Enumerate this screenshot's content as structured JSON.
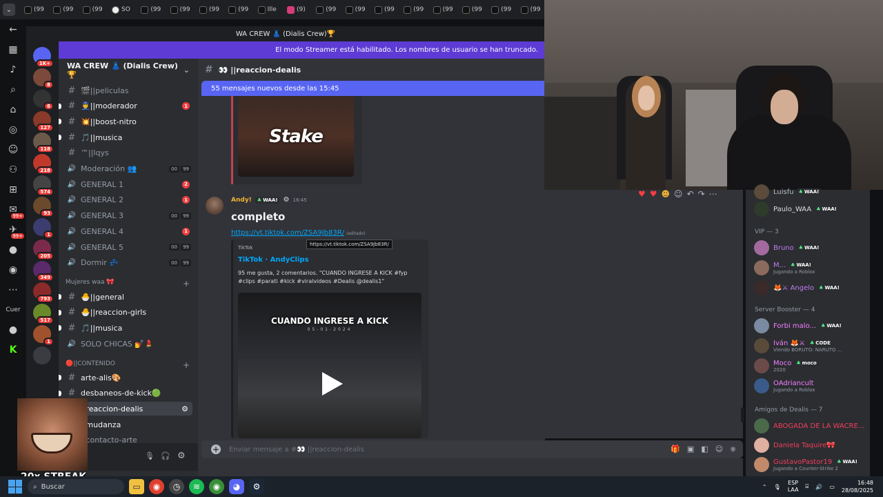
{
  "browser": {
    "tabs": [
      {
        "label": "(99",
        "icon": "tiktok"
      },
      {
        "label": "(99",
        "icon": "tiktok"
      },
      {
        "label": "(99",
        "icon": "tiktok"
      },
      {
        "label": "SO",
        "icon": "google"
      },
      {
        "label": "(99",
        "icon": "tiktok"
      },
      {
        "label": "(99",
        "icon": "tiktok"
      },
      {
        "label": "(99",
        "icon": "tiktok"
      },
      {
        "label": "(99",
        "icon": "tiktok"
      },
      {
        "label": "Ille",
        "icon": "tiktok"
      },
      {
        "label": "(9)",
        "icon": "instagram"
      },
      {
        "label": "(99",
        "icon": "tiktok"
      },
      {
        "label": "(99",
        "icon": "tiktok"
      },
      {
        "label": "(99",
        "icon": "tiktok"
      },
      {
        "label": "(99",
        "icon": "tiktok"
      },
      {
        "label": "(99",
        "icon": "tiktok"
      },
      {
        "label": "(99",
        "icon": "tiktok"
      },
      {
        "label": "(99",
        "icon": "tiktok"
      },
      {
        "label": "(99",
        "icon": "tiktok"
      }
    ],
    "rail_badges": {
      "b1": "99+",
      "b2": "99+"
    },
    "rail_cue_label": "Cuer"
  },
  "discord": {
    "window_title": "WA CREW 👗 (Dialis Crew)🏆",
    "streamer_notice": "El modo Streamer está habilitado. Los nombres de usuario se han truncado.",
    "guild_name": "WA CREW 👗 (Dialis Crew)🏆",
    "server_badges": [
      "1K+",
      "8",
      "6",
      "127",
      "118",
      "218",
      "574",
      "93",
      "1",
      "205",
      "349",
      "793",
      "517",
      "1"
    ],
    "channels": [
      {
        "name": "🎬||peliculas",
        "kind": "text",
        "unread": false,
        "badge": ""
      },
      {
        "name": "👮||moderador",
        "kind": "text",
        "unread": true,
        "badge": "1"
      },
      {
        "name": "💥||boost-nitro",
        "kind": "text",
        "unread": true,
        "badge": ""
      },
      {
        "name": "🎵||musica",
        "kind": "text",
        "unread": true,
        "badge": ""
      },
      {
        "name": "™||lqys",
        "kind": "text",
        "unread": false,
        "badge": ""
      },
      {
        "name": "Moderación 👥",
        "kind": "voice",
        "unread": false,
        "counts": [
          "00",
          "99"
        ]
      },
      {
        "name": "GENERAL 1",
        "kind": "voice",
        "unread": false,
        "badge": "2"
      },
      {
        "name": "GENERAL 2",
        "kind": "voice",
        "unread": false,
        "badge": "1"
      },
      {
        "name": "GENERAL 3",
        "kind": "voice",
        "unread": false,
        "counts": [
          "00",
          "99"
        ]
      },
      {
        "name": "GENERAL 4",
        "kind": "voice",
        "unread": false,
        "badge": "1"
      },
      {
        "name": "GENERAL 5",
        "kind": "voice",
        "unread": false,
        "counts": [
          "00",
          "99"
        ]
      },
      {
        "name": "Dormir 💤",
        "kind": "voice",
        "unread": false,
        "counts": [
          "00",
          "99"
        ]
      }
    ],
    "category_women": "Mujeres waa 🎀",
    "channels_women": [
      {
        "name": "🐣||general",
        "kind": "text",
        "unread": true
      },
      {
        "name": "🐣||reaccion-girls",
        "kind": "text",
        "unread": true
      },
      {
        "name": "🎵||musica",
        "kind": "text",
        "unread": true
      },
      {
        "name": "SOLO CHICAS 💅💄",
        "kind": "voice",
        "unread": false
      }
    ],
    "category_content": "🔴||CONTENIDO",
    "channels_content": [
      {
        "name": "arte-alis🎨",
        "kind": "text",
        "unread": true
      },
      {
        "name": "desbaneos-de-kick🟢",
        "kind": "text",
        "unread": true
      },
      {
        "name": "||reaccion-dealis",
        "kind": "text",
        "unread": true,
        "active": true
      },
      {
        "name": "||mudanza",
        "kind": "text",
        "unread": true
      },
      {
        "name": "||contacto-arte",
        "kind": "text",
        "unread": false
      }
    ],
    "active_channel_header": "👀 ||reaccion-dealis",
    "new_messages_bar": "55 mensajes nuevos desde las 15:45",
    "stake_text": "Stake",
    "message": {
      "author": "Andy!",
      "role_tag": "WAA!",
      "time": "16:45",
      "text": "completo",
      "link": "https://vt.tiktok.com/ZSA9Jb83R/",
      "edited": "(editado)",
      "tooltip": "https://vt.tiktok.com/ZSA9Jb83R/"
    },
    "embed": {
      "provider": "TikTok",
      "title": "TikTok · AndyClips",
      "description": "95 me gusta, 2 comentarios. \"CUANDO INGRESE A KICK #fyp #clips #parati #kick #viralvideos #Dealis @dealis1\"",
      "video_caption": "CUANDO INGRESE A KICK",
      "video_date": "05-01-2024"
    },
    "input_placeholder": "Enviar mensaje a #👀 ||reaccion-dealis",
    "members": {
      "top": [
        {
          "name": "Luisfu",
          "tag": "WAA!",
          "color": "#b5bac1"
        },
        {
          "name": "Paulo_WAA",
          "tag": "WAA!",
          "color": "#dbdee1"
        }
      ],
      "vip_header": "VIP — 3",
      "vip": [
        {
          "name": "Bruno",
          "tag": "WAA!",
          "color": "#c27cf0",
          "sub": ""
        },
        {
          "name": "M...",
          "tag": "WAA!",
          "color": "#c27cf0",
          "sub": "Jugando a Roblox"
        },
        {
          "name": "🦊⚔ Angelo",
          "tag": "WAA!",
          "color": "#c27cf0",
          "sub": ""
        }
      ],
      "booster_header": "Server Booster — 4",
      "boosters": [
        {
          "name": "Forbi malo...",
          "tag": "WAA!",
          "color": "#f47fff",
          "sub": ""
        },
        {
          "name": "Iván 🦊⚔",
          "tag": "CODE",
          "color": "#f47fff",
          "sub": "Viendo BORUTO: NARUTO ..."
        },
        {
          "name": "Moco",
          "tag": "moco",
          "color": "#f47fff",
          "sub": "2020"
        },
        {
          "name": "OAdriancult",
          "tag": "",
          "color": "#f47fff",
          "sub": "Jugando a Roblox"
        }
      ],
      "friends_header": "Amigos de Dealis — 7",
      "friends": [
        {
          "name": "ABOGADA DE LA WACRE...",
          "tag": "",
          "color": "#f23f5c",
          "sub": ""
        },
        {
          "name": "Daniela Taquire🎀",
          "tag": "",
          "color": "#f23f5c",
          "sub": ""
        },
        {
          "name": "GustavoPastor19",
          "tag": "WAA!",
          "color": "#f23f5c",
          "sub": "Jugando a Counter-Strike 2"
        }
      ]
    }
  },
  "overlay": {
    "streak": "20x STREAK"
  },
  "taskbar": {
    "search": "Buscar",
    "lang_top": "ESP",
    "lang_bottom": "LAA",
    "time": "16:48",
    "date": "28/08/2025"
  }
}
